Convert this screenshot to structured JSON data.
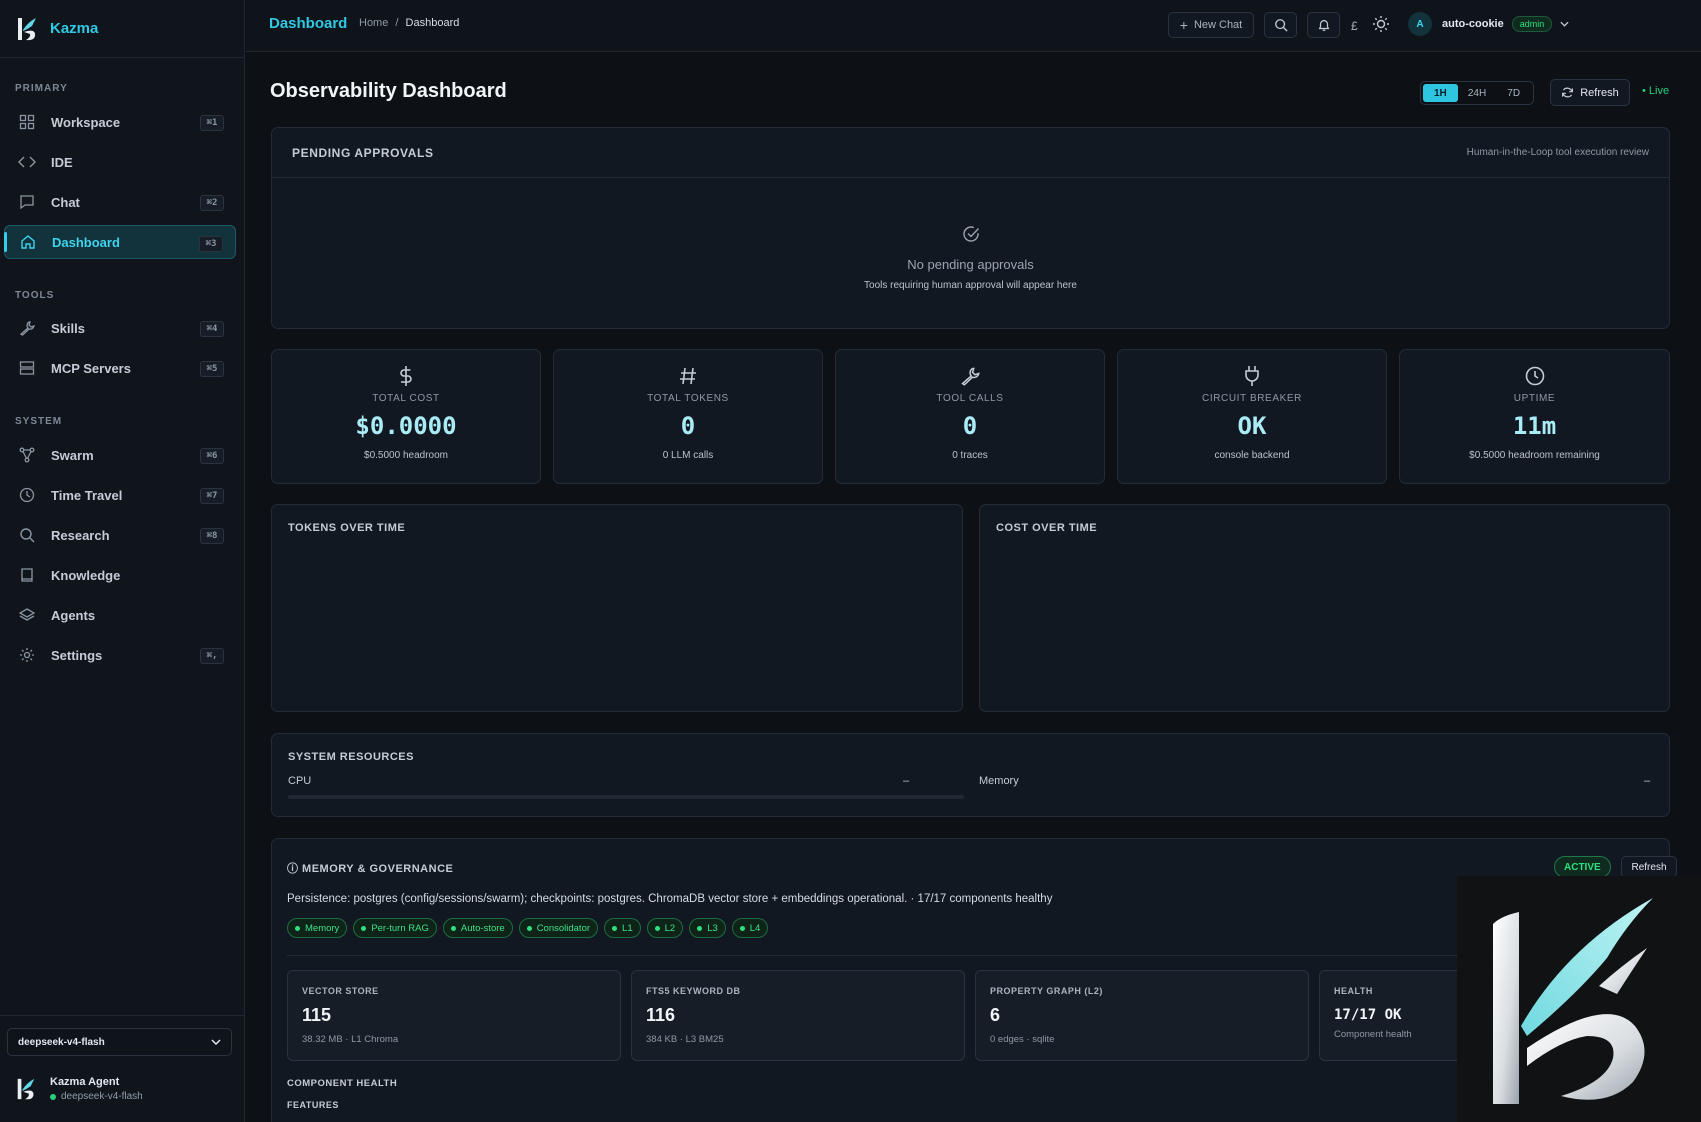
{
  "brand": {
    "name": "Kazma"
  },
  "sidebar": {
    "sections": {
      "primary": "PRIMARY",
      "tools": "TOOLS",
      "system": "SYSTEM"
    },
    "items": [
      {
        "label": "Workspace",
        "shortcut": "⌘1",
        "icon": "grid-icon"
      },
      {
        "label": "IDE",
        "shortcut": "",
        "icon": "code-icon"
      },
      {
        "label": "Chat",
        "shortcut": "⌘2",
        "icon": "chat-icon"
      },
      {
        "label": "Dashboard",
        "shortcut": "⌘3",
        "icon": "home-icon",
        "active": true
      },
      {
        "label": "Skills",
        "shortcut": "⌘4",
        "icon": "wrench-icon"
      },
      {
        "label": "MCP Servers",
        "shortcut": "⌘5",
        "icon": "server-icon"
      },
      {
        "label": "Swarm",
        "shortcut": "⌘6",
        "icon": "network-icon"
      },
      {
        "label": "Time Travel",
        "shortcut": "⌘7",
        "icon": "clock-icon"
      },
      {
        "label": "Research",
        "shortcut": "⌘8",
        "icon": "search-icon"
      },
      {
        "label": "Knowledge",
        "shortcut": "",
        "icon": "book-icon"
      },
      {
        "label": "Agents",
        "shortcut": "",
        "icon": "layers-icon"
      },
      {
        "label": "Settings",
        "shortcut": "⌘,",
        "icon": "gear-icon"
      }
    ],
    "model_select": "deepseek-v4-flash",
    "agent": {
      "name": "Kazma Agent",
      "model": "deepseek-v4-flash"
    }
  },
  "topbar": {
    "title": "Dashboard",
    "breadcrumb": {
      "home": "Home",
      "sep": "/",
      "current": "Dashboard"
    },
    "new_chat": "New Chat",
    "lang": "£",
    "avatar_initial": "A",
    "user": "auto-cookie",
    "role": "admin"
  },
  "main": {
    "title": "Observability Dashboard",
    "ranges": [
      "1H",
      "24H",
      "7D"
    ],
    "selected_range": "1H",
    "refresh": "Refresh",
    "live": "• Live",
    "pending": {
      "title": "PENDING APPROVALS",
      "subtitle": "Human-in-the-Loop tool execution review",
      "empty_title": "No pending approvals",
      "empty_sub": "Tools requiring human approval will appear here"
    },
    "stats": [
      {
        "label": "TOTAL COST",
        "value": "$0.0000",
        "sub": "$0.5000 headroom",
        "icon": "dollar-icon"
      },
      {
        "label": "TOTAL TOKENS",
        "value": "0",
        "sub": "0 LLM calls",
        "icon": "hash-icon"
      },
      {
        "label": "TOOL CALLS",
        "value": "0",
        "sub": "0 traces",
        "icon": "wrench-icon"
      },
      {
        "label": "CIRCUIT BREAKER",
        "value": "OK",
        "sub": "console backend",
        "icon": "plug-icon"
      },
      {
        "label": "UPTIME",
        "value": "11m",
        "sub": "$0.5000 headroom remaining",
        "icon": "clock-icon"
      }
    ],
    "charts": {
      "tokens": "TOKENS OVER TIME",
      "cost": "COST OVER TIME"
    },
    "resources": {
      "title": "SYSTEM RESOURCES",
      "cpu_label": "CPU",
      "cpu_value": "–",
      "mem_label": "Memory",
      "mem_value": "–"
    },
    "memory": {
      "title": "ⓘ MEMORY & GOVERNANCE",
      "status": "ACTIVE",
      "refresh": "Refresh",
      "persistence": "Persistence: postgres (config/sessions/swarm); checkpoints: postgres. ChromaDB vector store + embeddings operational. · 17/17 components healthy",
      "chips": [
        "Memory",
        "Per-turn RAG",
        "Auto-store",
        "Consolidator",
        "L1",
        "L2",
        "L3",
        "L4"
      ],
      "stores": [
        {
          "label": "VECTOR STORE",
          "value": "115",
          "sub": "38.32 MB · L1 Chroma"
        },
        {
          "label": "FTS5 KEYWORD DB",
          "value": "116",
          "sub": "384 KB · L3 BM25"
        },
        {
          "label": "PROPERTY GRAPH (L2)",
          "value": "6",
          "sub": "0 edges · sqlite"
        },
        {
          "label": "HEALTH",
          "value": "17/17 OK",
          "sub": "Component health"
        }
      ],
      "component_health": "COMPONENT HEALTH",
      "features": "FEATURES"
    }
  },
  "colors": {
    "accent": "#2fc9e4",
    "live": "#26d07c",
    "active_green": "#2ee07f"
  }
}
